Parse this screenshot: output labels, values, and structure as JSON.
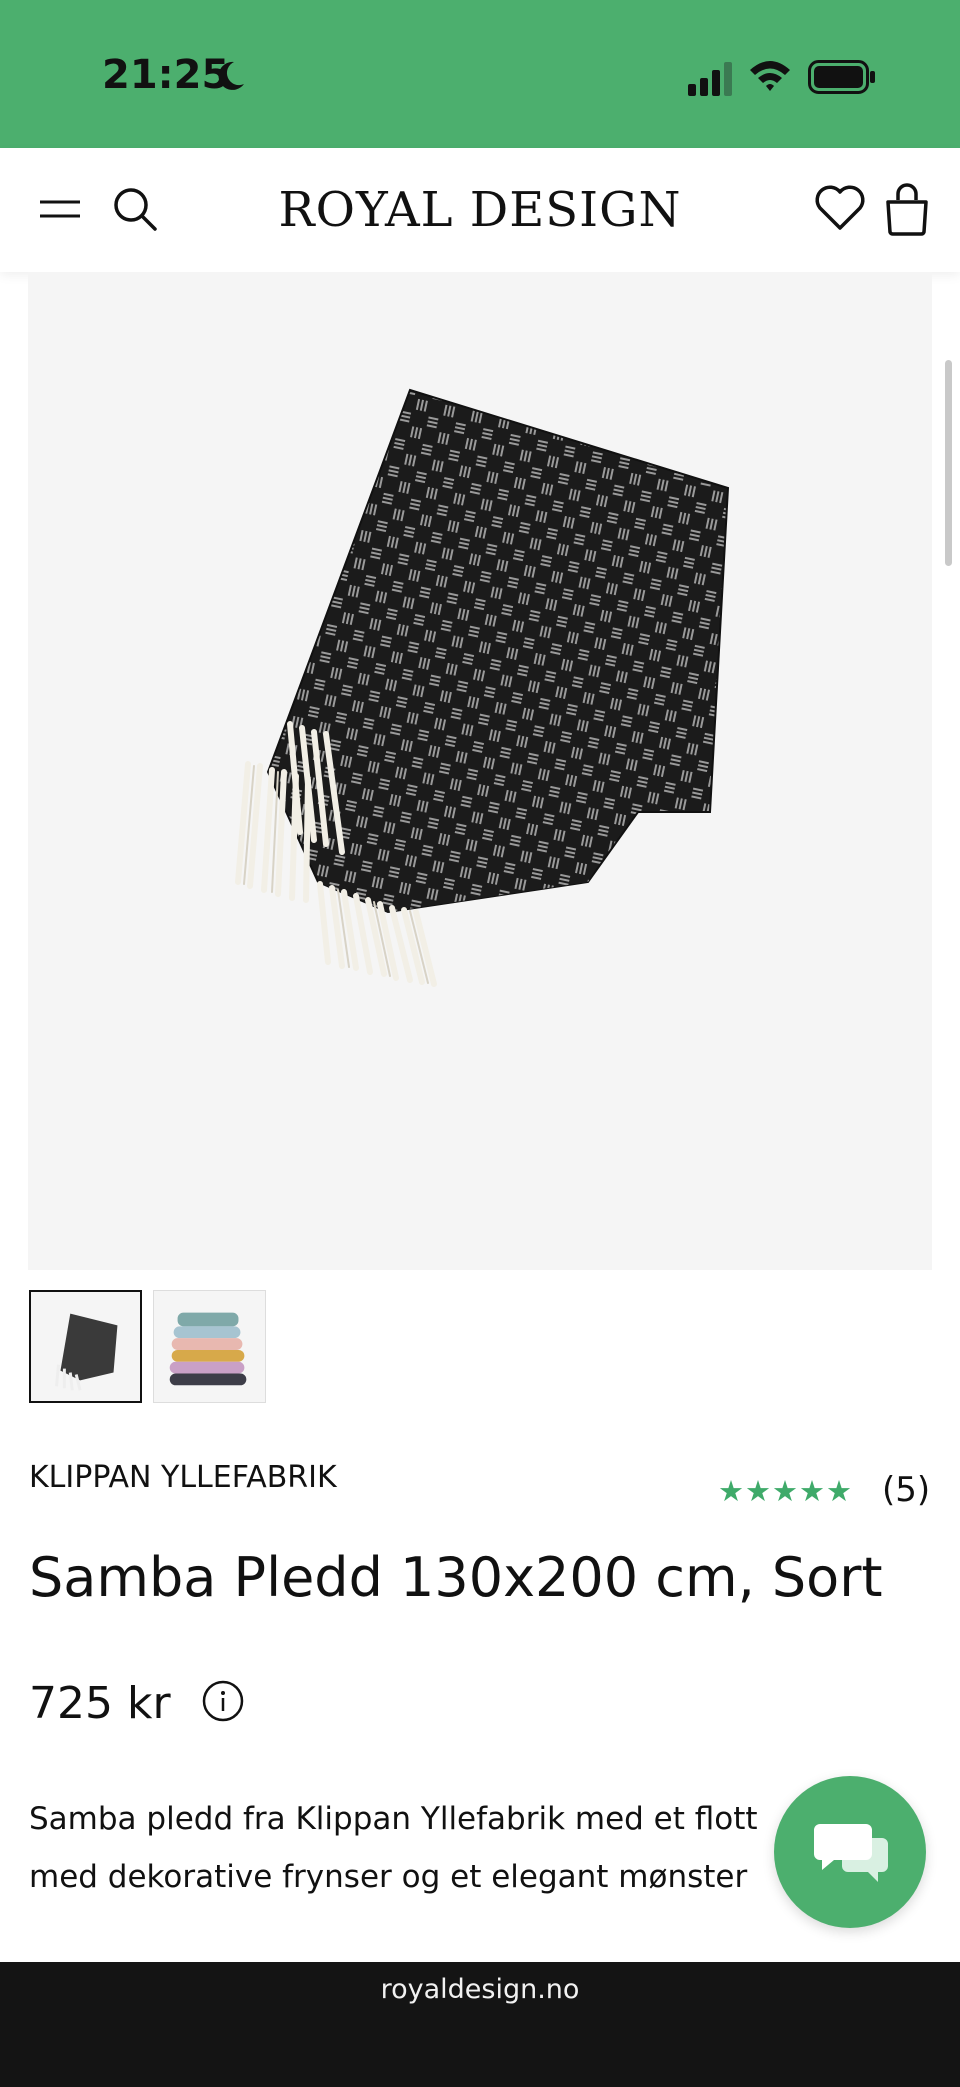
{
  "status_bar": {
    "time": "21:25",
    "background": "#4caf6e"
  },
  "header": {
    "logo": "ROYAL DESIGN",
    "icons": [
      "menu-icon",
      "search-icon",
      "heart-icon",
      "shopping-bag-icon"
    ]
  },
  "product": {
    "brand": "KLIPPAN YLLEFABRIK",
    "rating_stars": "★★★★★",
    "rating_count": "(5)",
    "title": "Samba Pledd 130x200 cm, Sort",
    "price": "725 kr",
    "description_line1": "Samba pledd fra Klippan Yllefabrik med et flott",
    "description_line2": "med dekorative frynser og et elegant mønster",
    "accent_color": "#3faa6a"
  },
  "gallery": {
    "thumbnails": [
      "black-blanket-thumbnail",
      "colored-blankets-stack-thumbnail"
    ],
    "active_index": 0
  },
  "browser": {
    "url": "royaldesign.no"
  }
}
